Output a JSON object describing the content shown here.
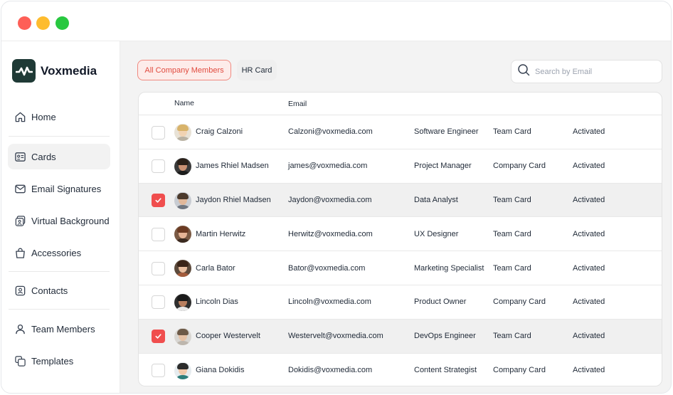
{
  "window": {
    "controls": [
      "close",
      "minimize",
      "maximize"
    ]
  },
  "brand": {
    "name": "Voxmedia",
    "logo_color": "#1f3a36"
  },
  "sidebar": {
    "items": [
      {
        "label": "Home",
        "icon": "home-icon",
        "active": false
      },
      {
        "label": "Cards",
        "icon": "cards-icon",
        "active": true
      },
      {
        "label": "Email Signatures",
        "icon": "mail-icon",
        "active": false
      },
      {
        "label": "Virtual Background",
        "icon": "background-icon",
        "active": false
      },
      {
        "label": "Accessories",
        "icon": "bag-icon",
        "active": false
      },
      {
        "label": "Contacts",
        "icon": "contact-icon",
        "active": false
      },
      {
        "label": "Team Members",
        "icon": "user-icon",
        "active": false
      },
      {
        "label": "Templates",
        "icon": "templates-icon",
        "active": false
      }
    ]
  },
  "tabs": [
    {
      "label": "All Company Members",
      "active": true
    },
    {
      "label": "HR Card",
      "active": false
    }
  ],
  "search": {
    "placeholder": "Search by Email",
    "value": ""
  },
  "table": {
    "headers": {
      "name": "Name",
      "email": "Email"
    },
    "rows": [
      {
        "name": "Craig Calzoni",
        "email": "Calzoni@voxmedia.com",
        "role": "Software Engineer",
        "card": "Team Card",
        "status": "Activated",
        "checked": false
      },
      {
        "name": "James Rhiel Madsen",
        "email": "james@voxmedia.com",
        "role": "Project Manager",
        "card": "Company Card",
        "status": "Activated",
        "checked": false
      },
      {
        "name": "Jaydon Rhiel Madsen",
        "email": "Jaydon@voxmedia.com",
        "role": "Data Analyst",
        "card": "Team Card",
        "status": "Activated",
        "checked": true
      },
      {
        "name": "Martin Herwitz",
        "email": "Herwitz@voxmedia.com",
        "role": "UX Designer",
        "card": "Team Card",
        "status": "Activated",
        "checked": false
      },
      {
        "name": "Carla Bator",
        "email": "Bator@voxmedia.com",
        "role": "Marketing Specialist",
        "card": "Team Card",
        "status": "Activated",
        "checked": false
      },
      {
        "name": "Lincoln Dias",
        "email": "Lincoln@voxmedia.com",
        "role": "Product Owner",
        "card": "Company Card",
        "status": "Activated",
        "checked": false
      },
      {
        "name": "Cooper Westervelt",
        "email": "Westervelt@voxmedia.com",
        "role": "DevOps Engineer",
        "card": "Team Card",
        "status": "Activated",
        "checked": true
      },
      {
        "name": "Giana Dokidis",
        "email": "Dokidis@voxmedia.com",
        "role": "Content Strategist",
        "card": "Company Card",
        "status": "Activated",
        "checked": false
      }
    ]
  },
  "colors": {
    "accent": "#f04e4e",
    "tab_active_bg": "#fdecea",
    "selected_row": "#f0f0f0"
  }
}
